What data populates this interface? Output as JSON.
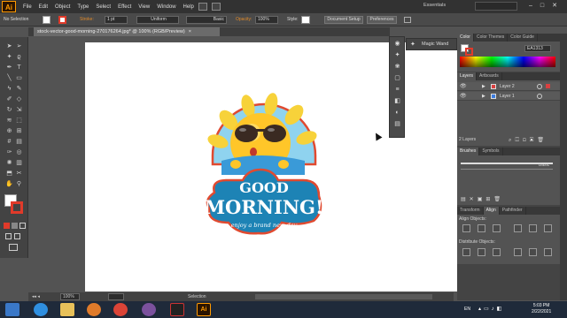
{
  "app": {
    "logo": "Ai",
    "menu": [
      "File",
      "Edit",
      "Object",
      "Type",
      "Select",
      "Effect",
      "View",
      "Window",
      "Help"
    ],
    "workspace": "Essentials",
    "window_controls": [
      "minimize",
      "maximize",
      "close"
    ]
  },
  "control_bar": {
    "selection_status": "No Selection",
    "stroke_label": "Stroke:",
    "stroke_value": "1 pt",
    "profile": "Uniform",
    "brush": "Basic",
    "opacity_label": "Opacity:",
    "opacity_value": "100%",
    "style_label": "Style:",
    "document_setup": "Document Setup",
    "preferences": "Preferences"
  },
  "document": {
    "tab_title": "stock-vector-good-morning-270176264.jpg* @ 100% (RGB/Preview)",
    "zoom": "100%",
    "status": "Selection"
  },
  "artwork": {
    "line1": "GOOD",
    "line2": "MORNING!",
    "line3": "enjoy a brand new day"
  },
  "floating_panel": {
    "magic_wand": "Magic Wand"
  },
  "color_panel": {
    "tabs": [
      "Color",
      "Color Themes",
      "Color Guide"
    ],
    "hex": "EA1313",
    "fill_color": "#ffffff",
    "stroke_color": "#e03a2a"
  },
  "layers_panel": {
    "tabs": [
      "Layers",
      "Artboards"
    ],
    "layers": [
      {
        "name": "Layer 2",
        "color": "#d94040"
      },
      {
        "name": "Layer 1",
        "color": "#3d7de0"
      }
    ],
    "count": "2 Layers"
  },
  "brushes_panel": {
    "tabs": [
      "Brushes",
      "Symbols"
    ],
    "brush_name": "Basic"
  },
  "align_panel": {
    "tabs": [
      "Transform",
      "Align",
      "Pathfinder"
    ],
    "align_objects": "Align Objects:",
    "distribute_objects": "Distribute Objects:"
  },
  "taskbar": {
    "language": "EN",
    "time": "5:03 PM",
    "date": "2/22/2021",
    "apps": [
      "start",
      "ie",
      "explorer",
      "media",
      "chrome",
      "viber",
      "photo",
      "illustrator"
    ]
  }
}
